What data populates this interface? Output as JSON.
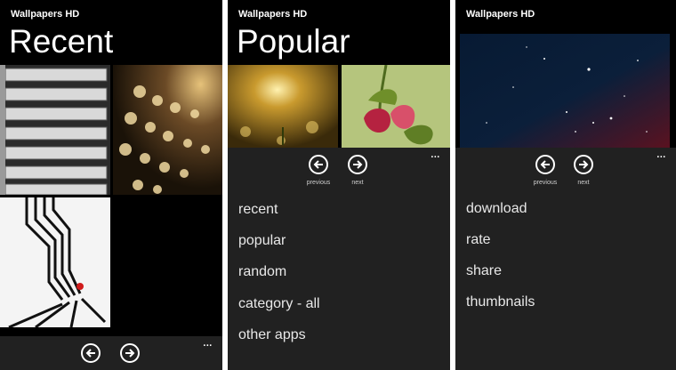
{
  "screens": [
    {
      "app_title": "Wallpapers HD",
      "page_title": "Recent",
      "thumbnails": [
        "books-shelf",
        "wine-bottles-bokeh",
        "abstract-lines-figure",
        "empty-slot"
      ],
      "nav": {
        "prev_icon": "arrow-left-icon",
        "next_icon": "arrow-right-icon"
      },
      "more": "..."
    },
    {
      "app_title": "Wallpapers HD",
      "page_title": "Popular",
      "thumbnails": [
        "golden-bokeh",
        "pink-flower"
      ],
      "nav": {
        "prev_label": "previous",
        "next_label": "next"
      },
      "more": "...",
      "menu": [
        "recent",
        "popular",
        "random",
        "category - all",
        "other apps"
      ]
    },
    {
      "app_title": "Wallpapers HD",
      "preview": "starry-sky",
      "nav": {
        "prev_label": "previous",
        "next_label": "next"
      },
      "more": "...",
      "menu": [
        "download",
        "rate",
        "share",
        "thumbnails"
      ]
    }
  ],
  "colors": {
    "background": "#000000",
    "appbar": "#212121",
    "text": "#ffffff"
  }
}
